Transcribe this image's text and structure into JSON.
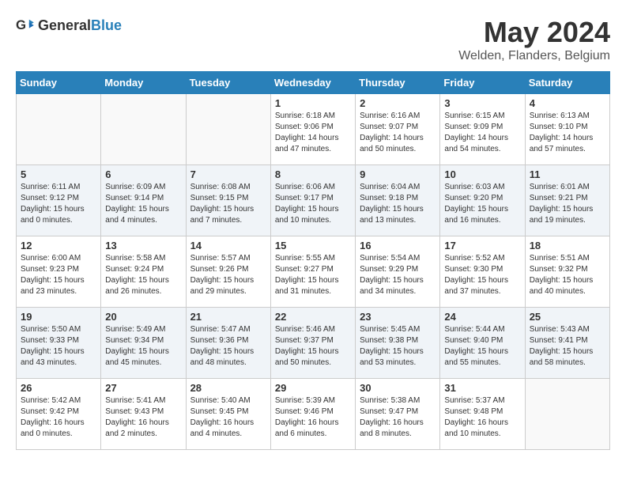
{
  "logo": {
    "general": "General",
    "blue": "Blue"
  },
  "title": {
    "month": "May 2024",
    "location": "Welden, Flanders, Belgium"
  },
  "headers": [
    "Sunday",
    "Monday",
    "Tuesday",
    "Wednesday",
    "Thursday",
    "Friday",
    "Saturday"
  ],
  "weeks": [
    [
      {
        "day": "",
        "sunrise": "",
        "sunset": "",
        "daylight": ""
      },
      {
        "day": "",
        "sunrise": "",
        "sunset": "",
        "daylight": ""
      },
      {
        "day": "",
        "sunrise": "",
        "sunset": "",
        "daylight": ""
      },
      {
        "day": "1",
        "sunrise": "Sunrise: 6:18 AM",
        "sunset": "Sunset: 9:06 PM",
        "daylight": "Daylight: 14 hours and 47 minutes."
      },
      {
        "day": "2",
        "sunrise": "Sunrise: 6:16 AM",
        "sunset": "Sunset: 9:07 PM",
        "daylight": "Daylight: 14 hours and 50 minutes."
      },
      {
        "day": "3",
        "sunrise": "Sunrise: 6:15 AM",
        "sunset": "Sunset: 9:09 PM",
        "daylight": "Daylight: 14 hours and 54 minutes."
      },
      {
        "day": "4",
        "sunrise": "Sunrise: 6:13 AM",
        "sunset": "Sunset: 9:10 PM",
        "daylight": "Daylight: 14 hours and 57 minutes."
      }
    ],
    [
      {
        "day": "5",
        "sunrise": "Sunrise: 6:11 AM",
        "sunset": "Sunset: 9:12 PM",
        "daylight": "Daylight: 15 hours and 0 minutes."
      },
      {
        "day": "6",
        "sunrise": "Sunrise: 6:09 AM",
        "sunset": "Sunset: 9:14 PM",
        "daylight": "Daylight: 15 hours and 4 minutes."
      },
      {
        "day": "7",
        "sunrise": "Sunrise: 6:08 AM",
        "sunset": "Sunset: 9:15 PM",
        "daylight": "Daylight: 15 hours and 7 minutes."
      },
      {
        "day": "8",
        "sunrise": "Sunrise: 6:06 AM",
        "sunset": "Sunset: 9:17 PM",
        "daylight": "Daylight: 15 hours and 10 minutes."
      },
      {
        "day": "9",
        "sunrise": "Sunrise: 6:04 AM",
        "sunset": "Sunset: 9:18 PM",
        "daylight": "Daylight: 15 hours and 13 minutes."
      },
      {
        "day": "10",
        "sunrise": "Sunrise: 6:03 AM",
        "sunset": "Sunset: 9:20 PM",
        "daylight": "Daylight: 15 hours and 16 minutes."
      },
      {
        "day": "11",
        "sunrise": "Sunrise: 6:01 AM",
        "sunset": "Sunset: 9:21 PM",
        "daylight": "Daylight: 15 hours and 19 minutes."
      }
    ],
    [
      {
        "day": "12",
        "sunrise": "Sunrise: 6:00 AM",
        "sunset": "Sunset: 9:23 PM",
        "daylight": "Daylight: 15 hours and 23 minutes."
      },
      {
        "day": "13",
        "sunrise": "Sunrise: 5:58 AM",
        "sunset": "Sunset: 9:24 PM",
        "daylight": "Daylight: 15 hours and 26 minutes."
      },
      {
        "day": "14",
        "sunrise": "Sunrise: 5:57 AM",
        "sunset": "Sunset: 9:26 PM",
        "daylight": "Daylight: 15 hours and 29 minutes."
      },
      {
        "day": "15",
        "sunrise": "Sunrise: 5:55 AM",
        "sunset": "Sunset: 9:27 PM",
        "daylight": "Daylight: 15 hours and 31 minutes."
      },
      {
        "day": "16",
        "sunrise": "Sunrise: 5:54 AM",
        "sunset": "Sunset: 9:29 PM",
        "daylight": "Daylight: 15 hours and 34 minutes."
      },
      {
        "day": "17",
        "sunrise": "Sunrise: 5:52 AM",
        "sunset": "Sunset: 9:30 PM",
        "daylight": "Daylight: 15 hours and 37 minutes."
      },
      {
        "day": "18",
        "sunrise": "Sunrise: 5:51 AM",
        "sunset": "Sunset: 9:32 PM",
        "daylight": "Daylight: 15 hours and 40 minutes."
      }
    ],
    [
      {
        "day": "19",
        "sunrise": "Sunrise: 5:50 AM",
        "sunset": "Sunset: 9:33 PM",
        "daylight": "Daylight: 15 hours and 43 minutes."
      },
      {
        "day": "20",
        "sunrise": "Sunrise: 5:49 AM",
        "sunset": "Sunset: 9:34 PM",
        "daylight": "Daylight: 15 hours and 45 minutes."
      },
      {
        "day": "21",
        "sunrise": "Sunrise: 5:47 AM",
        "sunset": "Sunset: 9:36 PM",
        "daylight": "Daylight: 15 hours and 48 minutes."
      },
      {
        "day": "22",
        "sunrise": "Sunrise: 5:46 AM",
        "sunset": "Sunset: 9:37 PM",
        "daylight": "Daylight: 15 hours and 50 minutes."
      },
      {
        "day": "23",
        "sunrise": "Sunrise: 5:45 AM",
        "sunset": "Sunset: 9:38 PM",
        "daylight": "Daylight: 15 hours and 53 minutes."
      },
      {
        "day": "24",
        "sunrise": "Sunrise: 5:44 AM",
        "sunset": "Sunset: 9:40 PM",
        "daylight": "Daylight: 15 hours and 55 minutes."
      },
      {
        "day": "25",
        "sunrise": "Sunrise: 5:43 AM",
        "sunset": "Sunset: 9:41 PM",
        "daylight": "Daylight: 15 hours and 58 minutes."
      }
    ],
    [
      {
        "day": "26",
        "sunrise": "Sunrise: 5:42 AM",
        "sunset": "Sunset: 9:42 PM",
        "daylight": "Daylight: 16 hours and 0 minutes."
      },
      {
        "day": "27",
        "sunrise": "Sunrise: 5:41 AM",
        "sunset": "Sunset: 9:43 PM",
        "daylight": "Daylight: 16 hours and 2 minutes."
      },
      {
        "day": "28",
        "sunrise": "Sunrise: 5:40 AM",
        "sunset": "Sunset: 9:45 PM",
        "daylight": "Daylight: 16 hours and 4 minutes."
      },
      {
        "day": "29",
        "sunrise": "Sunrise: 5:39 AM",
        "sunset": "Sunset: 9:46 PM",
        "daylight": "Daylight: 16 hours and 6 minutes."
      },
      {
        "day": "30",
        "sunrise": "Sunrise: 5:38 AM",
        "sunset": "Sunset: 9:47 PM",
        "daylight": "Daylight: 16 hours and 8 minutes."
      },
      {
        "day": "31",
        "sunrise": "Sunrise: 5:37 AM",
        "sunset": "Sunset: 9:48 PM",
        "daylight": "Daylight: 16 hours and 10 minutes."
      },
      {
        "day": "",
        "sunrise": "",
        "sunset": "",
        "daylight": ""
      }
    ]
  ]
}
